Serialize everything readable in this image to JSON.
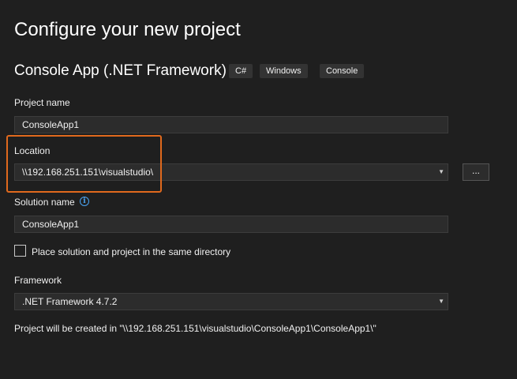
{
  "page": {
    "title": "Configure your new project"
  },
  "template": {
    "name": "Console App (.NET Framework)",
    "tags": [
      "C#",
      "Windows",
      "Console"
    ]
  },
  "project_name": {
    "label": "Project name",
    "value": "ConsoleApp1"
  },
  "location": {
    "label": "Location",
    "value": "\\\\192.168.251.151\\visualstudio\\",
    "browse_label": "..."
  },
  "solution_name": {
    "label": "Solution name",
    "value": "ConsoleApp1",
    "info_glyph": "i"
  },
  "same_directory": {
    "label": "Place solution and project in the same directory",
    "checked": false
  },
  "framework": {
    "label": "Framework",
    "value": ".NET Framework 4.7.2"
  },
  "creation_note": "Project will be created in \"\\\\192.168.251.151\\visualstudio\\ConsoleApp1\\ConsoleApp1\\\"",
  "colors": {
    "background": "#1f1f1f",
    "highlight": "#e0691d",
    "info": "#4aa3f0"
  }
}
